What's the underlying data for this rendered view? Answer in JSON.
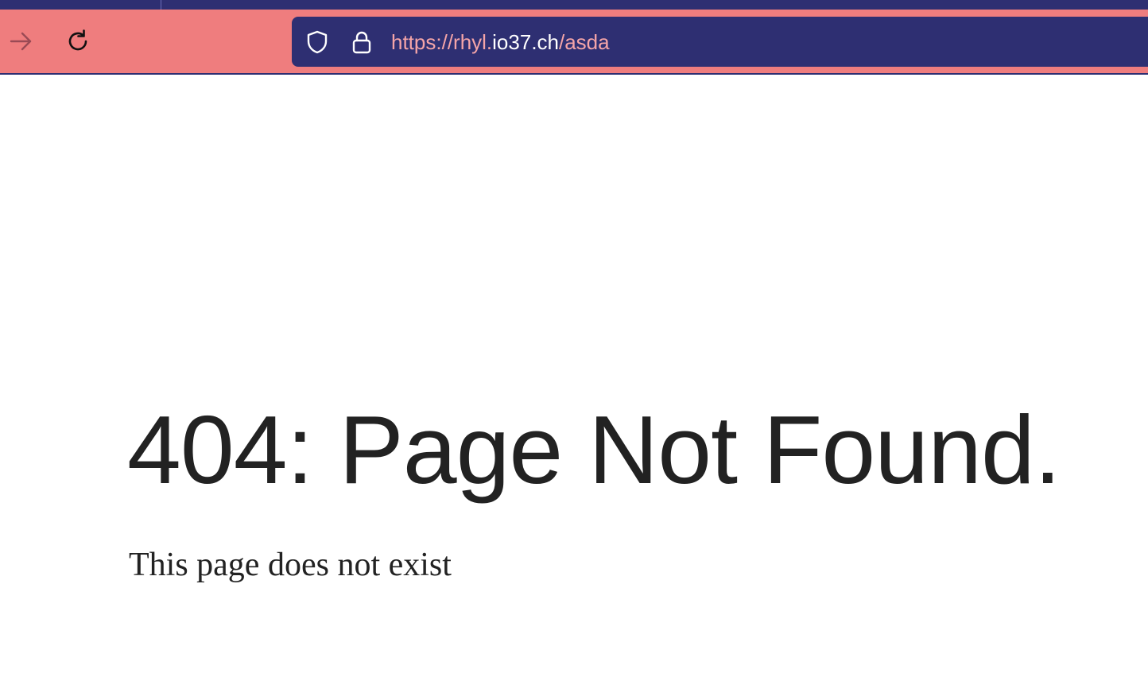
{
  "browser": {
    "nav": {
      "forward_icon": "arrow-right-icon",
      "reload_icon": "reload-icon"
    },
    "urlbar": {
      "shield_icon": "shield-icon",
      "lock_icon": "lock-icon",
      "url_prefix": "https://rhyl.",
      "url_host": "io37.ch",
      "url_path": "/asda"
    },
    "colors": {
      "toolbar": "#ef7d7e",
      "urlbar": "#2e2f72",
      "url_dim": "#f5a5a8",
      "url_host": "#ffffff"
    }
  },
  "page": {
    "headline": "404: Page Not Found.",
    "message": "This page does not exist",
    "text_color": "#222222"
  }
}
